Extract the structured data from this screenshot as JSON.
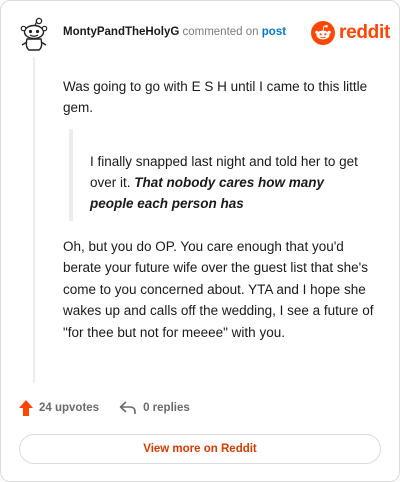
{
  "header": {
    "username": "MontyPandTheHolyG",
    "commented_text": "commented on",
    "post_link": "post",
    "brand_name": "reddit"
  },
  "comment": {
    "paragraph1": "Was going to go with E S H until I came to this little gem.",
    "quote_text": "I finally snapped last night and told her to get over it.",
    "quote_emphasis": "That nobody cares how many people each person has",
    "paragraph2": "Oh, but you do OP. You care enough that you'd berate your future wife over the guest list that she's come to you concerned about. YTA and I hope she wakes up and calls off the wedding, I see a future of \"for thee but not for meeee\" with you."
  },
  "footer": {
    "upvotes": "24 upvotes",
    "replies": "0 replies"
  },
  "view_more_label": "View more on Reddit",
  "colors": {
    "brand": "#ff4500",
    "link": "#0079d3",
    "view_more_text": "#d93a00"
  }
}
